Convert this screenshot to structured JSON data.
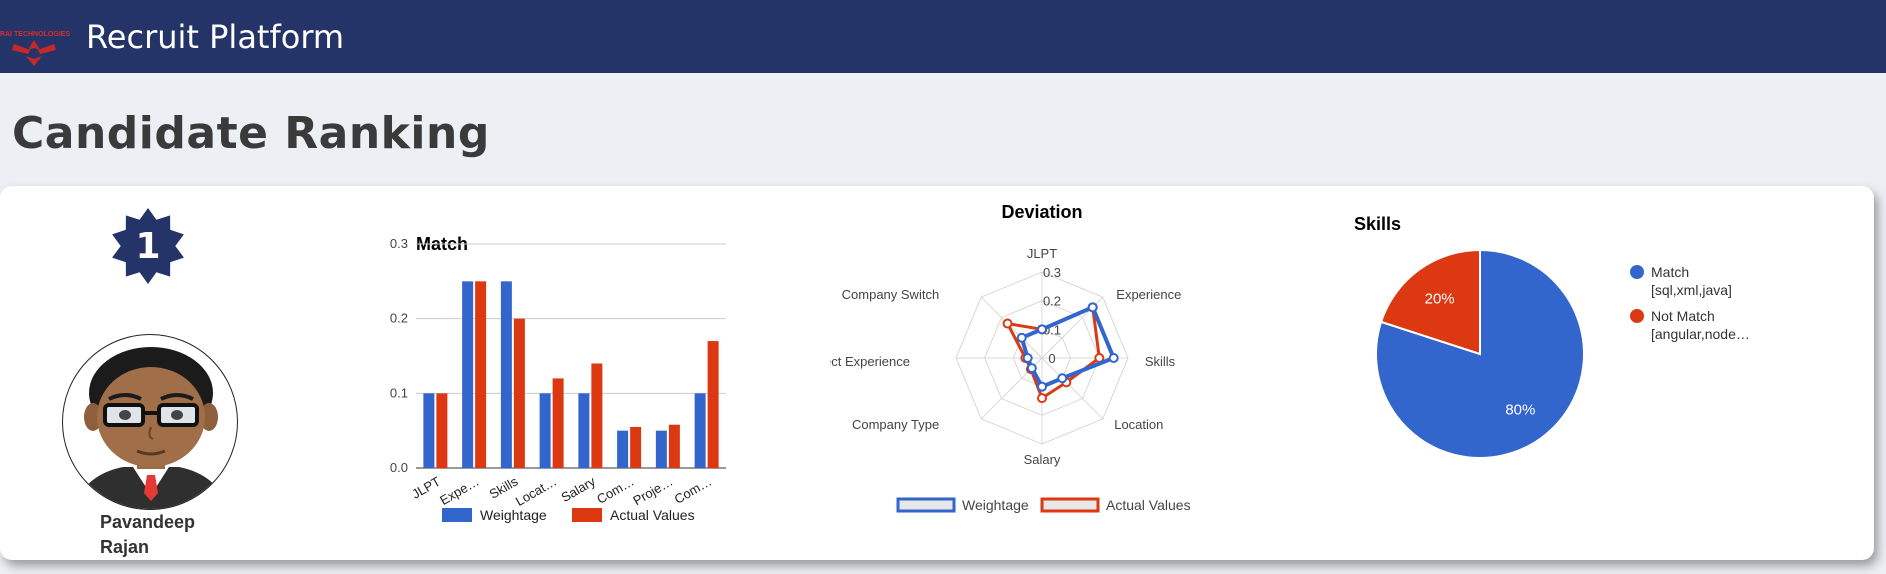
{
  "header": {
    "logo_text": "RAI TECHNOLOGIES",
    "app_title": "Recruit Platform"
  },
  "page": {
    "title": "Candidate Ranking"
  },
  "candidate": {
    "rank": "1",
    "name_line1": "Pavandeep",
    "name_line2": "Rajan"
  },
  "colors": {
    "blue": "#3366cc",
    "red": "#dc3912",
    "navy": "#253468"
  },
  "chart_data": [
    {
      "type": "bar",
      "title": "Match",
      "categories": [
        "JLPT",
        "Expe…",
        "Skills",
        "Locat…",
        "Salary",
        "Com…",
        "Proje…",
        "Com…"
      ],
      "series": [
        {
          "name": "Weightage",
          "values": [
            0.1,
            0.25,
            0.25,
            0.1,
            0.1,
            0.05,
            0.05,
            0.1
          ]
        },
        {
          "name": "Actual Values",
          "values": [
            0.1,
            0.25,
            0.2,
            0.12,
            0.14,
            0.055,
            0.058,
            0.17
          ]
        }
      ],
      "ylim": [
        0,
        0.3
      ],
      "yticks": [
        "0.0",
        "0.1",
        "0.2",
        "0.3"
      ],
      "grid": true,
      "legend": "bottom"
    },
    {
      "type": "radar",
      "title": "Deviation",
      "categories": [
        "JLPT",
        "Experience",
        "Skills",
        "Location",
        "Salary",
        "Company Type",
        "Project Experience",
        "Company Switch"
      ],
      "series": [
        {
          "name": "Weightage",
          "values": [
            0.1,
            0.25,
            0.25,
            0.1,
            0.1,
            0.05,
            0.05,
            0.1
          ]
        },
        {
          "name": "Actual Values",
          "values": [
            0.1,
            0.25,
            0.2,
            0.12,
            0.14,
            0.055,
            0.058,
            0.17
          ]
        }
      ],
      "rlim": [
        0,
        0.3
      ],
      "rticks": [
        "0",
        "0.1",
        "0.2",
        "0.3"
      ],
      "legend": "bottom"
    },
    {
      "type": "pie",
      "title": "Skills",
      "slices": [
        {
          "name": "Match",
          "detail": "[sql,xml,java]",
          "value": 80,
          "label": "80%"
        },
        {
          "name": "Not Match",
          "detail": "[angular,node…",
          "value": 20,
          "label": "20%"
        }
      ],
      "legend": "right"
    }
  ]
}
